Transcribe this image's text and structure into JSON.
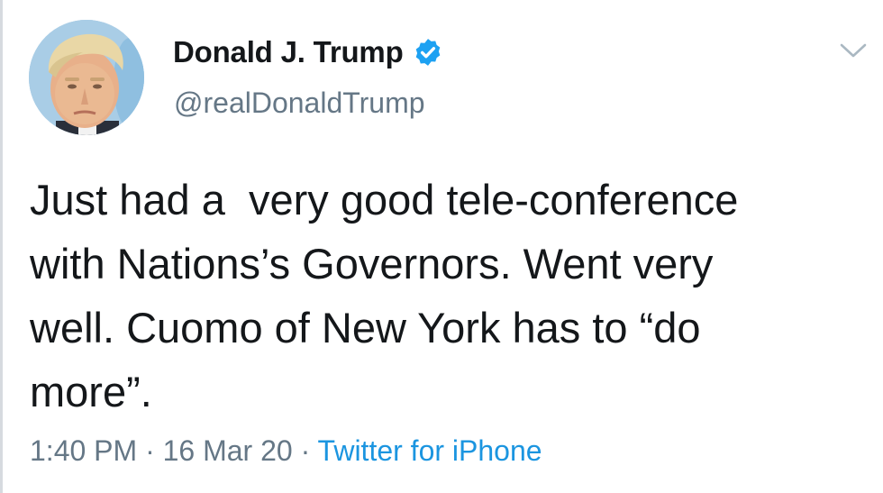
{
  "tweet": {
    "author": {
      "display_name": "Donald J. Trump",
      "handle": "@realDonaldTrump",
      "verified": true,
      "verified_icon": "verified-badge-icon"
    },
    "text_lines": [
      "Just had a  very good tele-conference",
      "with Nations’s Governors. Went very",
      "well. Cuomo of New York has to “do",
      "more”."
    ],
    "time": "1:40 PM",
    "date": "16 Mar 20",
    "separator": "·",
    "source": "Twitter for iPhone",
    "menu_icon": "chevron-down-icon"
  },
  "colors": {
    "text": "#14171a",
    "secondary": "#657786",
    "accent": "#1b95e0",
    "verified": "#1da1f2"
  }
}
